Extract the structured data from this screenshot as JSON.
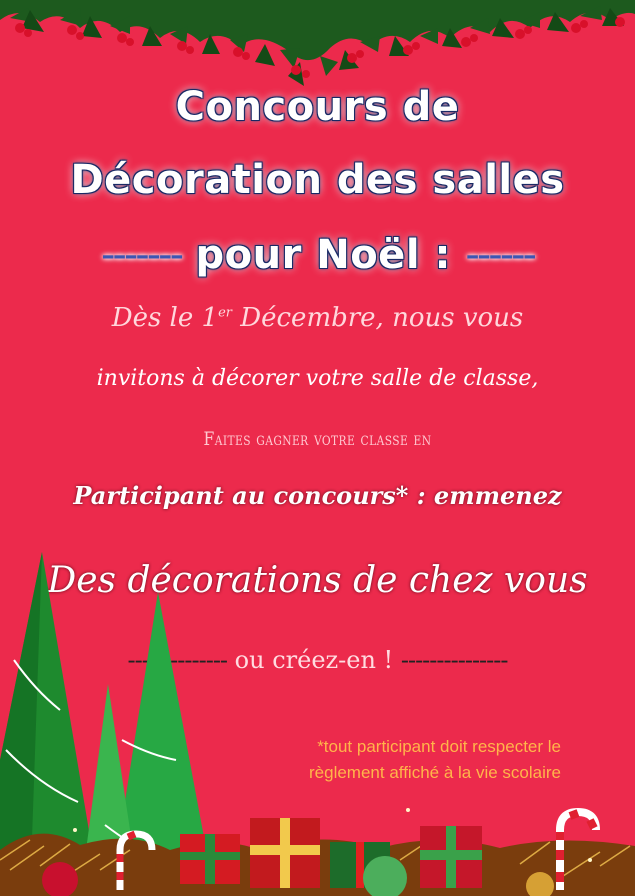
{
  "title": {
    "line1": "Concours de",
    "line2": "Décoration des salles",
    "line3_dash_left": "-------",
    "line3_text": "pour Noël :",
    "line3_dash_right": "------"
  },
  "body": {
    "line1_a": "Dès le 1",
    "line1_sup": "er",
    "line1_b": " Décembre, nous vous",
    "line2": "invitons à décorer votre salle de classe,",
    "line3": "Faites gagner votre classe en",
    "line4": "Participant au concours* : emmenez",
    "line5": "Des décorations de chez vous",
    "line6_dash_left": "--------------",
    "line6_text": " ou créez-en ! ",
    "line6_dash_right": "---------------"
  },
  "footnote": {
    "line1": "*tout participant doit respecter le",
    "line2": "règlement affiché à la vie scolaire"
  },
  "colors": {
    "background": "#ec2a4c",
    "title_outline": "#1a2a66",
    "footnote": "#ffb54a"
  },
  "icons": [
    "holly-garland-icon",
    "christmas-tree-icon",
    "gift-boxes-icon",
    "candy-cane-icon"
  ]
}
